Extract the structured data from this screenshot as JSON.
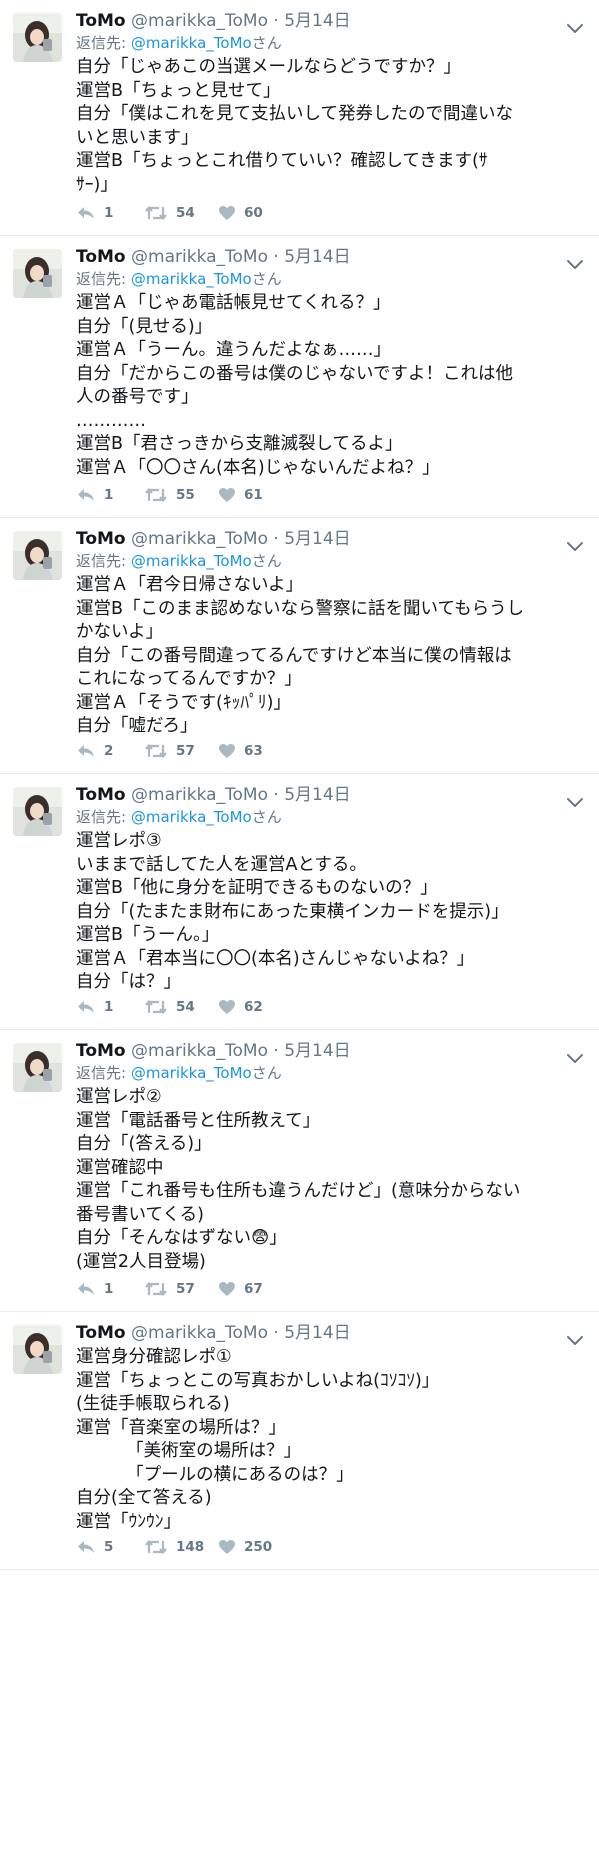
{
  "tweets": [
    {
      "name": "ToMo",
      "handle": "@marikka_ToMo",
      "dot": "·",
      "date": "5月14日",
      "reply_label": "返信先:",
      "reply_handle": "@marikka_ToMo",
      "reply_suffix": "さん",
      "lines": [
        "自分「じゃあこの当選メールならどうですか？」",
        "運営B「ちょっと見せて」",
        "自分「僕はこれを見て支払いして発券したので間違いな",
        "いと思います」",
        "運営B「ちょっとこれ借りていい？確認してきます(ｻ",
        "ｻｰ)」"
      ],
      "replies": "1",
      "retweets": "54",
      "likes": "60"
    },
    {
      "name": "ToMo",
      "handle": "@marikka_ToMo",
      "dot": "·",
      "date": "5月14日",
      "reply_label": "返信先:",
      "reply_handle": "@marikka_ToMo",
      "reply_suffix": "さん",
      "lines": [
        "運営Ａ「じゃあ電話帳見せてくれる？」",
        "自分「(見せる)」",
        "運営Ａ「うーん。違うんだよなぁ……」",
        "自分「だからこの番号は僕のじゃないですよ！これは他",
        "人の番号です」",
        "…………",
        "運営B「君さっきから支離滅裂してるよ」",
        "運営Ａ「〇〇さん(本名)じゃないんだよね？」"
      ],
      "replies": "1",
      "retweets": "55",
      "likes": "61"
    },
    {
      "name": "ToMo",
      "handle": "@marikka_ToMo",
      "dot": "·",
      "date": "5月14日",
      "reply_label": "返信先:",
      "reply_handle": "@marikka_ToMo",
      "reply_suffix": "さん",
      "lines": [
        "運営Ａ「君今日帰さないよ」",
        "運営B「このまま認めないなら警察に話を聞いてもらうし",
        "かないよ」",
        "自分「この番号間違ってるんですけど本当に僕の情報は",
        "これになってるんですか？」",
        "運営Ａ「そうです(ｷｯﾊﾟﾘ)」",
        "自分「嘘だろ」"
      ],
      "replies": "2",
      "retweets": "57",
      "likes": "63"
    },
    {
      "name": "ToMo",
      "handle": "@marikka_ToMo",
      "dot": "·",
      "date": "5月14日",
      "reply_label": "返信先:",
      "reply_handle": "@marikka_ToMo",
      "reply_suffix": "さん",
      "lines": [
        "運営レポ③",
        "いままで話してた人を運営Aとする。",
        "運営B「他に身分を証明できるものないの？」",
        "自分「(たまたま財布にあった東横インカードを提示)」",
        "運営B「うーん。」",
        "運営Ａ「君本当に〇〇(本名)さんじゃないよね？」",
        "自分「は？」"
      ],
      "replies": "1",
      "retweets": "54",
      "likes": "62"
    },
    {
      "name": "ToMo",
      "handle": "@marikka_ToMo",
      "dot": "·",
      "date": "5月14日",
      "reply_label": "返信先:",
      "reply_handle": "@marikka_ToMo",
      "reply_suffix": "さん",
      "lines": [
        "運営レポ②",
        "運営「電話番号と住所教えて」",
        "自分「(答える)」",
        "運営確認中",
        "運営「これ番号も住所も違うんだけど」(意味分からない",
        "番号書いてくる)",
        "自分「そんなはずない😨」",
        "(運営2人目登場)"
      ],
      "replies": "1",
      "retweets": "57",
      "likes": "67"
    },
    {
      "name": "ToMo",
      "handle": "@marikka_ToMo",
      "dot": "·",
      "date": "5月14日",
      "reply_label": "",
      "reply_handle": "",
      "reply_suffix": "",
      "lines": [
        "運営身分確認レポ①",
        "運営「ちょっとこの写真おかしいよね(ｺｿｺｿ)」",
        "(生徒手帳取られる)",
        "運営「音楽室の場所は？」",
        "         「美術室の場所は？」",
        "         「プールの横にあるのは？」",
        "自分(全て答える)",
        "運営「ｳﾝｳﾝ」"
      ],
      "replies": "5",
      "retweets": "148",
      "likes": "250"
    }
  ],
  "icons": {
    "reply": "reply-icon",
    "retweet": "retweet-icon",
    "like": "heart-icon",
    "caret": "chevron-down-icon"
  },
  "colors": {
    "secondary": "#657786",
    "link": "#1b95e0",
    "divider": "#e6ecf0",
    "icon": "#aab8c2"
  }
}
